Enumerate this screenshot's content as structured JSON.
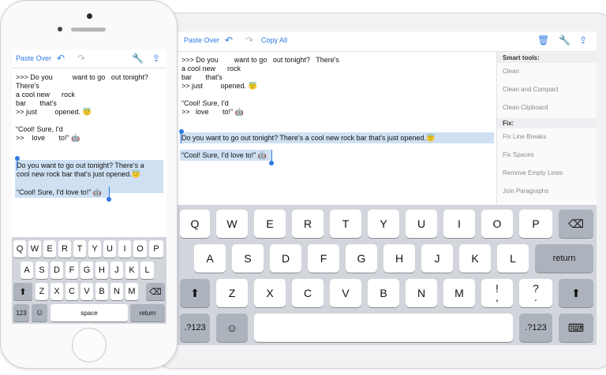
{
  "toolbar": {
    "paste_over": "Paste Over",
    "copy_all": "Copy All"
  },
  "icons": {
    "undo": "↶",
    "redo": "↷",
    "trash": "🗑",
    "wrench": "🔧",
    "share": "⇪",
    "backspace": "⌫",
    "shift": "⬆",
    "emoji": "☺",
    "keyboard_dismiss": "⌨"
  },
  "emoji": {
    "smile": "😇",
    "robot": "🤖"
  },
  "ipad_text": {
    "lines": [
      ">>> Do you        want to go   out tonight?   There's",
      "a cool new      rock",
      "bar       that's",
      ">> just         opened."
    ],
    "lines2": [
      "“Cool! Sure, I'd",
      ">>   love       to!”"
    ],
    "selected": [
      "Do you want to go out tonight? There's a cool new rock bar that's just opened.",
      "“Cool! Sure, I'd love to!”"
    ]
  },
  "iphone_text": {
    "lines": [
      ">>> Do you          want to go   out tonight?",
      "There's",
      "a cool new      rock",
      "bar       that's",
      ">> just         opened."
    ],
    "lines2": [
      "“Cool! Sure, I'd",
      ">>    love       to!”"
    ],
    "selected": [
      "Do you want to go out tonight? There's a",
      "cool new rock bar that's just opened."
    ],
    "selected2": "“Cool! Sure, I'd love to!”"
  },
  "side_panel": {
    "smart_tools_header": "Smart tools:",
    "smart_tools": [
      "Clean",
      "Clean and Compact",
      "Clean Clipboard"
    ],
    "fix_header": "Fix:",
    "fix_items": [
      "Fix Line Breaks",
      "Fix Spaces",
      "Remove Empty Lines",
      "Join Paragraphs"
    ]
  },
  "keyboard_ipad": {
    "row1": [
      "Q",
      "W",
      "E",
      "R",
      "T",
      "Y",
      "U",
      "I",
      "O",
      "P"
    ],
    "row2": [
      "A",
      "S",
      "D",
      "F",
      "G",
      "H",
      "J",
      "K",
      "L"
    ],
    "row3": [
      "Z",
      "X",
      "C",
      "V",
      "B",
      "N",
      "M"
    ],
    "excl": "!",
    "comma": ",",
    "question": "?",
    "period": ".",
    "return": "return",
    "num": ".?123"
  },
  "keyboard_iphone": {
    "row1": [
      "Q",
      "W",
      "E",
      "R",
      "T",
      "Y",
      "U",
      "I",
      "O",
      "P"
    ],
    "row2": [
      "A",
      "S",
      "D",
      "F",
      "G",
      "H",
      "J",
      "K",
      "L"
    ],
    "row3": [
      "Z",
      "X",
      "C",
      "V",
      "B",
      "N",
      "M"
    ],
    "num": "123",
    "space": "space",
    "return": "return"
  }
}
